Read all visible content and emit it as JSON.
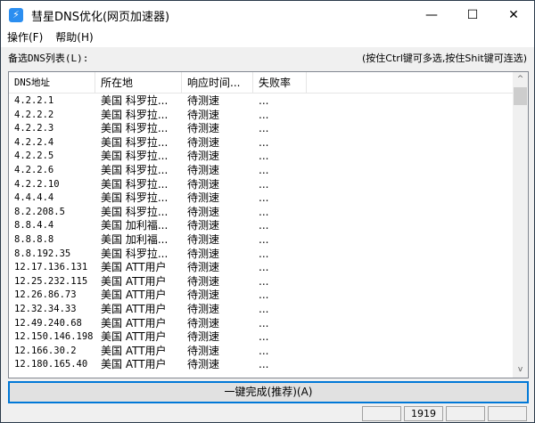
{
  "window": {
    "title": "彗星DNS优化(网页加速器)",
    "minimize": "—",
    "maximize": "☐",
    "close": "✕"
  },
  "menu": [
    "操作(F)",
    "帮助(H)"
  ],
  "list_label": "备选DNS列表(L):",
  "hint": "(按住Ctrl键可多选,按住Shit键可连选)",
  "columns": [
    "DNS地址",
    "所在地",
    "响应时间...",
    "失败率"
  ],
  "rows": [
    [
      "4.2.2.1",
      "美国 科罗拉...",
      "待测速",
      "..."
    ],
    [
      "4.2.2.2",
      "美国 科罗拉...",
      "待测速",
      "..."
    ],
    [
      "4.2.2.3",
      "美国 科罗拉...",
      "待测速",
      "..."
    ],
    [
      "4.2.2.4",
      "美国 科罗拉...",
      "待测速",
      "..."
    ],
    [
      "4.2.2.5",
      "美国 科罗拉...",
      "待测速",
      "..."
    ],
    [
      "4.2.2.6",
      "美国 科罗拉...",
      "待测速",
      "..."
    ],
    [
      "4.2.2.10",
      "美国 科罗拉...",
      "待测速",
      "..."
    ],
    [
      "4.4.4.4",
      "美国 科罗拉...",
      "待测速",
      "..."
    ],
    [
      "8.2.208.5",
      "美国 科罗拉...",
      "待测速",
      "..."
    ],
    [
      "8.8.4.4",
      "美国 加利福...",
      "待测速",
      "..."
    ],
    [
      "8.8.8.8",
      "美国 加利福...",
      "待测速",
      "..."
    ],
    [
      "8.8.192.35",
      "美国 科罗拉...",
      "待测速",
      "..."
    ],
    [
      "12.17.136.131",
      "美国 ATT用户",
      "待测速",
      "..."
    ],
    [
      "12.25.232.115",
      "美国 ATT用户",
      "待测速",
      "..."
    ],
    [
      "12.26.86.73",
      "美国 ATT用户",
      "待测速",
      "..."
    ],
    [
      "12.32.34.33",
      "美国 ATT用户",
      "待测速",
      "..."
    ],
    [
      "12.49.240.68",
      "美国 ATT用户",
      "待测速",
      "..."
    ],
    [
      "12.150.146.198",
      "美国 ATT用户",
      "待测速",
      "..."
    ],
    [
      "12.166.30.2",
      "美国 ATT用户",
      "待测速",
      "..."
    ],
    [
      "12.180.165.40",
      "美国 ATT用户",
      "待测速",
      "..."
    ]
  ],
  "scroll_up": "^",
  "scroll_down": "v",
  "one_click_button": "一键完成(推荐)(A)",
  "status": [
    "",
    "1919",
    "",
    ""
  ]
}
